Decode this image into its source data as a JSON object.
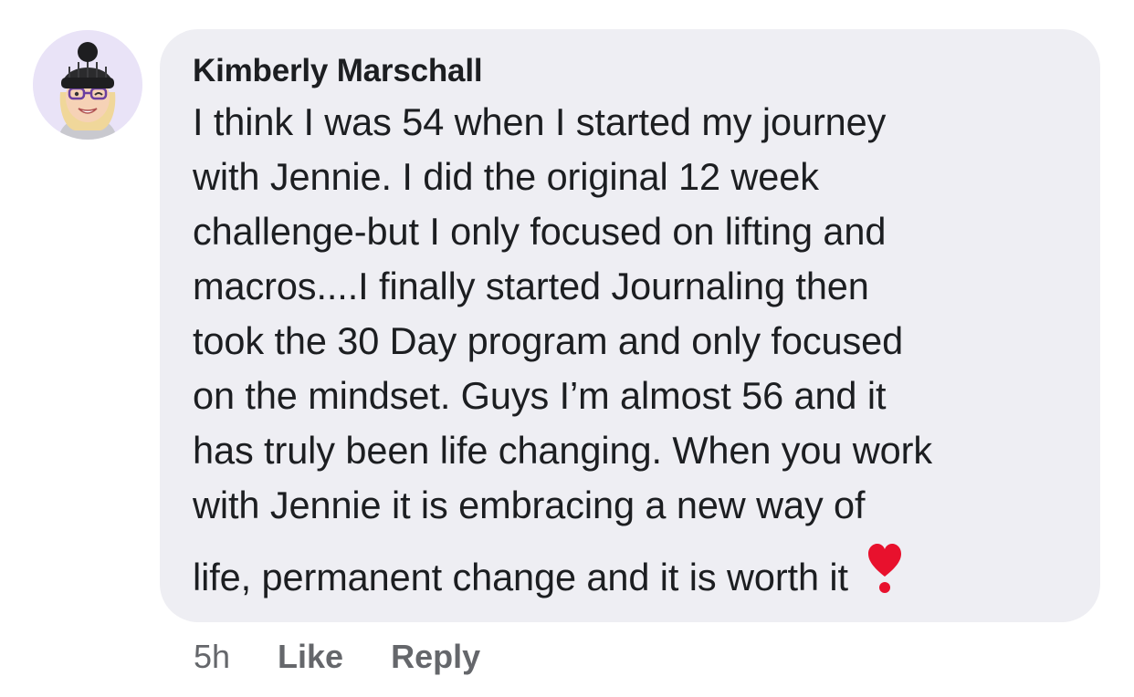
{
  "comment": {
    "author": "Kimberly Marschall",
    "body_lines": [
      "I think I was 54 when I started my journey",
      "with Jennie. I did the original 12 week",
      "challenge-but I only focused on lifting and",
      "macros....I finally started Journaling then",
      "took the 30 Day program and only focused",
      "on the mindset. Guys I’m almost 56 and it",
      "has truly been life changing. When you work",
      "with Jennie it is embracing a new way of",
      "life, permanent change and it is worth it"
    ],
    "emoji_icon": "heart-exclamation-icon",
    "timestamp": "5h",
    "like_label": "Like",
    "reply_label": "Reply"
  },
  "colors": {
    "bubble_bg": "#eeeef3",
    "text": "#1c1e21",
    "secondary_text": "#65676b",
    "avatar_bg": "#e9e3f7",
    "heart": "#e8112d"
  }
}
